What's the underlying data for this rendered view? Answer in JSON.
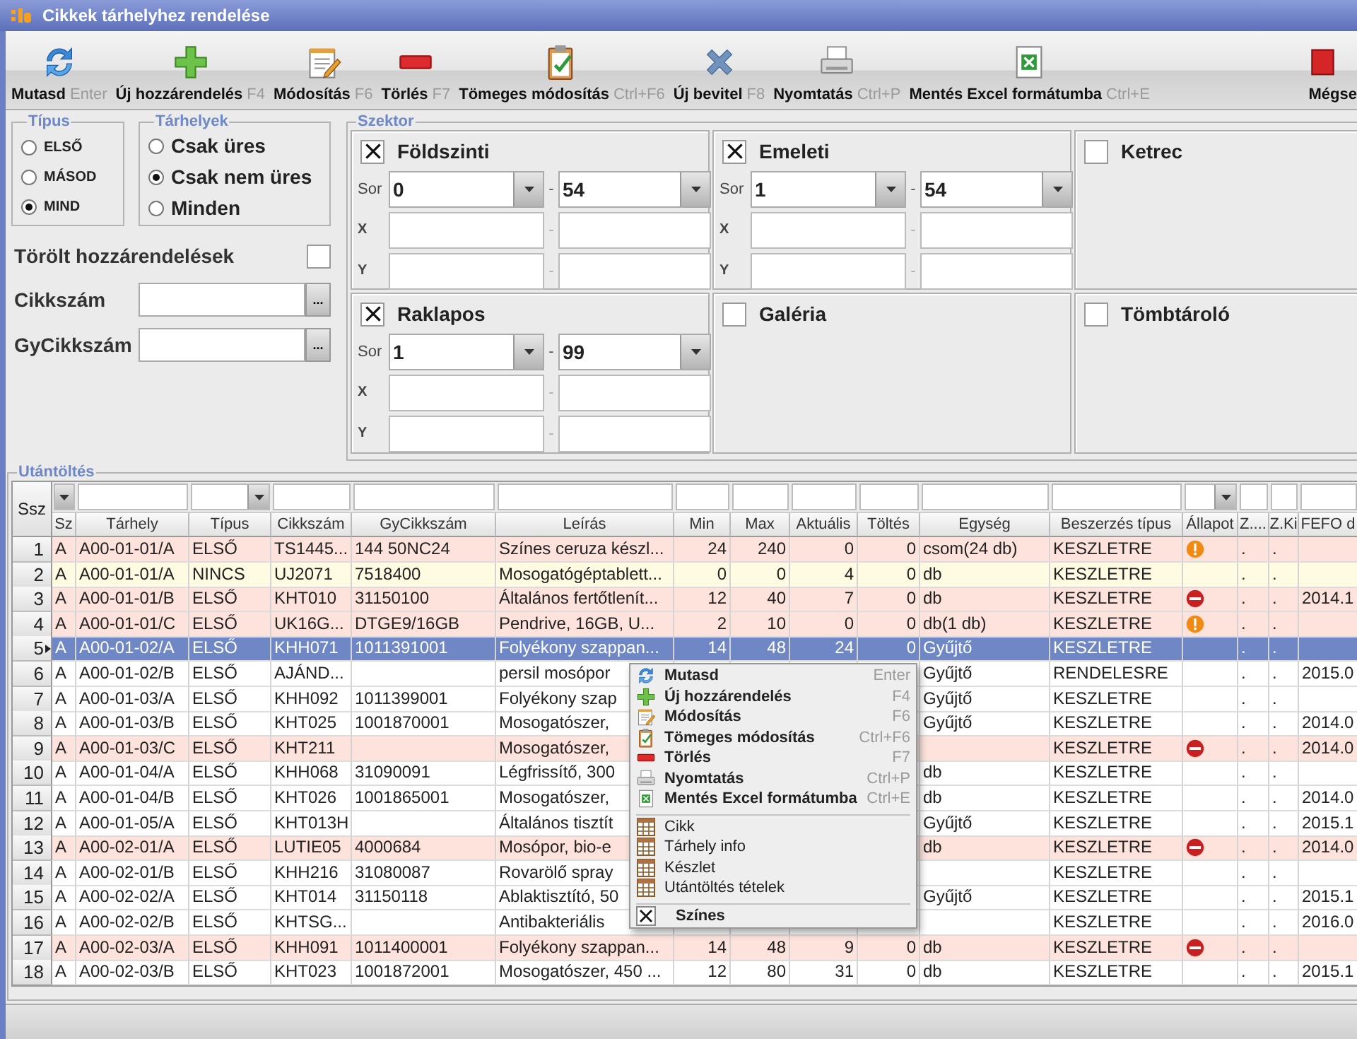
{
  "window": {
    "title": "Cikkek tárhelyhez rendelése"
  },
  "toolbar": [
    {
      "label": "Mutasd",
      "shortcut": "Enter"
    },
    {
      "label": "Új hozzárendelés",
      "shortcut": "F4"
    },
    {
      "label": "Módosítás",
      "shortcut": "F6"
    },
    {
      "label": "Törlés",
      "shortcut": "F7"
    },
    {
      "label": "Tömeges módosítás",
      "shortcut": "Ctrl+F6"
    },
    {
      "label": "Új bevitel",
      "shortcut": "F8"
    },
    {
      "label": "Nyomtatás",
      "shortcut": "Ctrl+P"
    },
    {
      "label": "Mentés Excel formátumba",
      "shortcut": "Ctrl+E"
    },
    {
      "label": "Mégse"
    }
  ],
  "tipus": {
    "title": "Típus",
    "options": [
      {
        "label": "ELSŐ",
        "selected": false
      },
      {
        "label": "MÁSOD",
        "selected": false
      },
      {
        "label": "MIND",
        "selected": true
      }
    ]
  },
  "tarhelyek": {
    "title": "Tárhelyek",
    "options": [
      {
        "label": "Csak üres",
        "selected": false
      },
      {
        "label": "Csak nem üres",
        "selected": true
      },
      {
        "label": "Minden",
        "selected": false
      }
    ]
  },
  "torolt": {
    "label": "Törölt hozzárendelések",
    "checked": false
  },
  "search_fields": [
    {
      "label": "Cikkszám",
      "button": "..."
    },
    {
      "label": "GyCikkszám",
      "button": "..."
    }
  ],
  "szektor": {
    "title": "Szektor",
    "panels": [
      {
        "label": "Földszinti",
        "checked": true,
        "fields": [
          {
            "label": "Sor",
            "kind": "combo",
            "from": "0",
            "dash": "-",
            "to": "54"
          },
          {
            "label": "X",
            "kind": "text",
            "dash": "-"
          },
          {
            "label": "Y",
            "kind": "text",
            "dash": "-"
          }
        ]
      },
      {
        "label": "Emeleti",
        "checked": true,
        "fields": [
          {
            "label": "Sor",
            "kind": "combo",
            "from": "1",
            "dash": "-",
            "to": "54"
          },
          {
            "label": "X",
            "kind": "text",
            "dash": "-"
          },
          {
            "label": "Y",
            "kind": "text",
            "dash": "-"
          }
        ]
      },
      {
        "label": "Ketrec",
        "checked": false
      },
      {
        "label": "Raklapos",
        "checked": true,
        "fields": [
          {
            "label": "Sor",
            "kind": "combo",
            "from": "1",
            "dash": "-",
            "to": "99"
          },
          {
            "label": "X",
            "kind": "text",
            "dash": "-"
          },
          {
            "label": "Y",
            "kind": "text",
            "dash": "-"
          }
        ]
      },
      {
        "label": "Galéria",
        "checked": false
      },
      {
        "label": "Tömbtároló",
        "checked": false
      }
    ]
  },
  "utantoltes": {
    "title": "Utántöltés",
    "row_header": "Ssz",
    "filter_row": [
      {
        "kind": "dropdown"
      },
      {
        "kind": "text"
      },
      {
        "kind": "dropdown"
      },
      {
        "kind": "text"
      },
      {
        "kind": "text"
      },
      {
        "kind": "text"
      },
      {
        "kind": "text"
      },
      {
        "kind": "text"
      },
      {
        "kind": "text"
      },
      {
        "kind": "text"
      },
      {
        "kind": "text"
      },
      {
        "kind": "text"
      },
      {
        "kind": "dropdown"
      },
      {
        "kind": "text"
      },
      {
        "kind": "text"
      },
      {
        "kind": "text"
      }
    ],
    "columns": [
      {
        "label": "Sz"
      },
      {
        "label": "Tárhely"
      },
      {
        "label": "Típus"
      },
      {
        "label": "Cikkszám"
      },
      {
        "label": "GyCikkszám"
      },
      {
        "label": "Leírás"
      },
      {
        "label": "Min"
      },
      {
        "label": "Max"
      },
      {
        "label": "Aktuális"
      },
      {
        "label": "Töltés"
      },
      {
        "label": "Egység"
      },
      {
        "label": "Beszerzés típus"
      },
      {
        "label": "Állapot"
      },
      {
        "label": "Z...."
      },
      {
        "label": "Z.Ki"
      },
      {
        "label": "FEFO d"
      }
    ],
    "rows": [
      {
        "ssz": "1",
        "sz": "A",
        "tarhely": "A00-01-01/A",
        "tipus": "ELSŐ",
        "cikkszam": "TS1445...",
        "gycikkszam": "144 50NC24",
        "leiras": "Színes ceruza készl...",
        "min": "24",
        "max": "240",
        "aktualis": "0",
        "toltes": "0",
        "egyseg": "csom(24 db)",
        "beszerzes": "KESZLETRE",
        "allapot": {
          "kind": "warning"
        },
        "z1": ".",
        "z2": ".",
        "color": "#fde3dc",
        "selected": false
      },
      {
        "ssz": "2",
        "sz": "A",
        "tarhely": "A00-01-01/A",
        "tipus": "NINCS",
        "cikkszam": "UJ2071",
        "gycikkszam": "7518400",
        "leiras": "Mosogatógéptablett...",
        "min": "0",
        "max": "0",
        "aktualis": "4",
        "toltes": "0",
        "egyseg": "db",
        "beszerzes": "KESZLETRE",
        "z1": ".",
        "z2": ".",
        "color": "#fffbe3",
        "selected": false
      },
      {
        "ssz": "3",
        "sz": "A",
        "tarhely": "A00-01-01/B",
        "tipus": "ELSŐ",
        "cikkszam": "KHT010",
        "gycikkszam": "31150100",
        "leiras": "Általános fertőtlenít...",
        "min": "12",
        "max": "40",
        "aktualis": "7",
        "toltes": "0",
        "egyseg": "db",
        "beszerzes": "KESZLETRE",
        "allapot": {
          "kind": "error"
        },
        "z1": ".",
        "z2": ".",
        "fefo": "2014.1",
        "color": "#fde3dc",
        "selected": false
      },
      {
        "ssz": "4",
        "sz": "A",
        "tarhely": "A00-01-01/C",
        "tipus": "ELSŐ",
        "cikkszam": "UK16G...",
        "gycikkszam": "DTGE9/16GB",
        "leiras": "Pendrive, 16GB, U...",
        "min": "2",
        "max": "10",
        "aktualis": "0",
        "toltes": "0",
        "egyseg": "db(1 db)",
        "beszerzes": "KESZLETRE",
        "allapot": {
          "kind": "warning"
        },
        "z1": ".",
        "z2": ".",
        "color": "#fde3dc",
        "selected": false
      },
      {
        "ssz": "5",
        "sz": "A",
        "tarhely": "A00-01-02/A",
        "tipus": "ELSŐ",
        "cikkszam": "KHH071",
        "gycikkszam": "1011391001",
        "leiras": "Folyékony szappan...",
        "min": "14",
        "max": "48",
        "aktualis": "24",
        "toltes": "0",
        "egyseg": "Gyűjtő",
        "beszerzes": "KESZLETRE",
        "z1": ".",
        "z2": ".",
        "selected": true
      },
      {
        "ssz": "6",
        "sz": "A",
        "tarhely": "A00-01-02/B",
        "tipus": "ELSŐ",
        "cikkszam": "AJÁND...",
        "leiras": "persil mosópor",
        "egyseg": "Gyűjtő",
        "beszerzes": "RENDELESRE",
        "z1": ".",
        "z2": ".",
        "fefo": "2015.0",
        "selected": false
      },
      {
        "ssz": "7",
        "sz": "A",
        "tarhely": "A00-01-03/A",
        "tipus": "ELSŐ",
        "cikkszam": "KHH092",
        "gycikkszam": "1011399001",
        "leiras": "Folyékony szap",
        "egyseg": "Gyűjtő",
        "beszerzes": "KESZLETRE",
        "z1": ".",
        "z2": ".",
        "selected": false
      },
      {
        "ssz": "8",
        "sz": "A",
        "tarhely": "A00-01-03/B",
        "tipus": "ELSŐ",
        "cikkszam": "KHT025",
        "gycikkszam": "1001870001",
        "leiras": "Mosogatószer,",
        "egyseg": "Gyűjtő",
        "beszerzes": "KESZLETRE",
        "z1": ".",
        "z2": ".",
        "fefo": "2014.0",
        "selected": false
      },
      {
        "ssz": "9",
        "sz": "A",
        "tarhely": "A00-01-03/C",
        "tipus": "ELSŐ",
        "cikkszam": "KHT211",
        "leiras": "Mosogatószer,",
        "beszerzes": "KESZLETRE",
        "allapot": {
          "kind": "error"
        },
        "z1": ".",
        "z2": ".",
        "fefo": "2014.0",
        "color": "#fde3dc",
        "selected": false
      },
      {
        "ssz": "10",
        "sz": "A",
        "tarhely": "A00-01-04/A",
        "tipus": "ELSŐ",
        "cikkszam": "KHH068",
        "gycikkszam": "31090091",
        "leiras": "Légfrissítő, 300",
        "egyseg": "db",
        "beszerzes": "KESZLETRE",
        "z1": ".",
        "z2": ".",
        "selected": false
      },
      {
        "ssz": "11",
        "sz": "A",
        "tarhely": "A00-01-04/B",
        "tipus": "ELSŐ",
        "cikkszam": "KHT026",
        "gycikkszam": "1001865001",
        "leiras": "Mosogatószer,",
        "egyseg": "db",
        "beszerzes": "KESZLETRE",
        "z1": ".",
        "z2": ".",
        "fefo": "2014.0",
        "selected": false
      },
      {
        "ssz": "12",
        "sz": "A",
        "tarhely": "A00-01-05/A",
        "tipus": "ELSŐ",
        "cikkszam": "KHT013H",
        "leiras": "Általános tisztít",
        "egyseg": "Gyűjtő",
        "beszerzes": "KESZLETRE",
        "z1": ".",
        "z2": ".",
        "fefo": "2015.1",
        "selected": false
      },
      {
        "ssz": "13",
        "sz": "A",
        "tarhely": "A00-02-01/A",
        "tipus": "ELSŐ",
        "cikkszam": "LUTIE05",
        "gycikkszam": "4000684",
        "leiras": "Mosópor, bio-e",
        "egyseg": "db",
        "beszerzes": "KESZLETRE",
        "allapot": {
          "kind": "error"
        },
        "z1": ".",
        "z2": ".",
        "fefo": "2014.0",
        "color": "#fde3dc",
        "selected": false
      },
      {
        "ssz": "14",
        "sz": "A",
        "tarhely": "A00-02-01/B",
        "tipus": "ELSŐ",
        "cikkszam": "KHH216",
        "gycikkszam": "31080087",
        "leiras": "Rovarölő spray",
        "beszerzes": "KESZLETRE",
        "z1": ".",
        "z2": ".",
        "selected": false
      },
      {
        "ssz": "15",
        "sz": "A",
        "tarhely": "A00-02-02/A",
        "tipus": "ELSŐ",
        "cikkszam": "KHT014",
        "gycikkszam": "31150118",
        "leiras": "Ablaktisztító, 50",
        "egyseg": "Gyűjtő",
        "beszerzes": "KESZLETRE",
        "z1": ".",
        "z2": ".",
        "fefo": "2015.1",
        "selected": false
      },
      {
        "ssz": "16",
        "sz": "A",
        "tarhely": "A00-02-02/B",
        "tipus": "ELSŐ",
        "cikkszam": "KHTSG...",
        "leiras": "Antibakteriális",
        "beszerzes": "KESZLETRE",
        "z1": ".",
        "z2": ".",
        "fefo": "2016.0",
        "selected": false
      },
      {
        "ssz": "17",
        "sz": "A",
        "tarhely": "A00-02-03/A",
        "tipus": "ELSŐ",
        "cikkszam": "KHH091",
        "gycikkszam": "1011400001",
        "leiras": "Folyékony szappan...",
        "min": "14",
        "max": "48",
        "aktualis": "9",
        "toltes": "0",
        "egyseg": "db",
        "beszerzes": "KESZLETRE",
        "allapot": {
          "kind": "error"
        },
        "z1": ".",
        "z2": ".",
        "color": "#fde3dc",
        "selected": false
      },
      {
        "ssz": "18",
        "sz": "A",
        "tarhely": "A00-02-03/B",
        "tipus": "ELSŐ",
        "cikkszam": "KHT023",
        "gycikkszam": "1001872001",
        "leiras": "Mosogatószer, 450 ...",
        "min": "12",
        "max": "80",
        "aktualis": "31",
        "toltes": "0",
        "egyseg": "db",
        "beszerzes": "KESZLETRE",
        "z1": ".",
        "z2": ".",
        "fefo": "2015.1",
        "selected": false
      }
    ]
  },
  "context_menu": {
    "sections": [
      [
        {
          "kind": "command",
          "label": "Mutasd",
          "shortcut": "Enter"
        },
        {
          "kind": "command",
          "label": "Új hozzárendelés",
          "shortcut": "F4"
        },
        {
          "kind": "command",
          "label": "Módosítás",
          "shortcut": "F6"
        },
        {
          "kind": "command",
          "label": "Tömeges módosítás",
          "shortcut": "Ctrl+F6"
        },
        {
          "kind": "command",
          "label": "Törlés",
          "shortcut": "F7"
        },
        {
          "kind": "command",
          "label": "Nyomtatás",
          "shortcut": "Ctrl+P"
        },
        {
          "kind": "command",
          "label": "Mentés Excel formátumba",
          "shortcut": "Ctrl+E"
        }
      ],
      [
        {
          "kind": "view",
          "label": "Cikk"
        },
        {
          "kind": "view",
          "label": "Tárhely info"
        },
        {
          "kind": "view",
          "label": "Készlet"
        },
        {
          "kind": "view",
          "label": "Utántöltés tételek"
        }
      ],
      [
        {
          "kind": "check",
          "label": "Színes",
          "checked": true
        }
      ]
    ]
  }
}
